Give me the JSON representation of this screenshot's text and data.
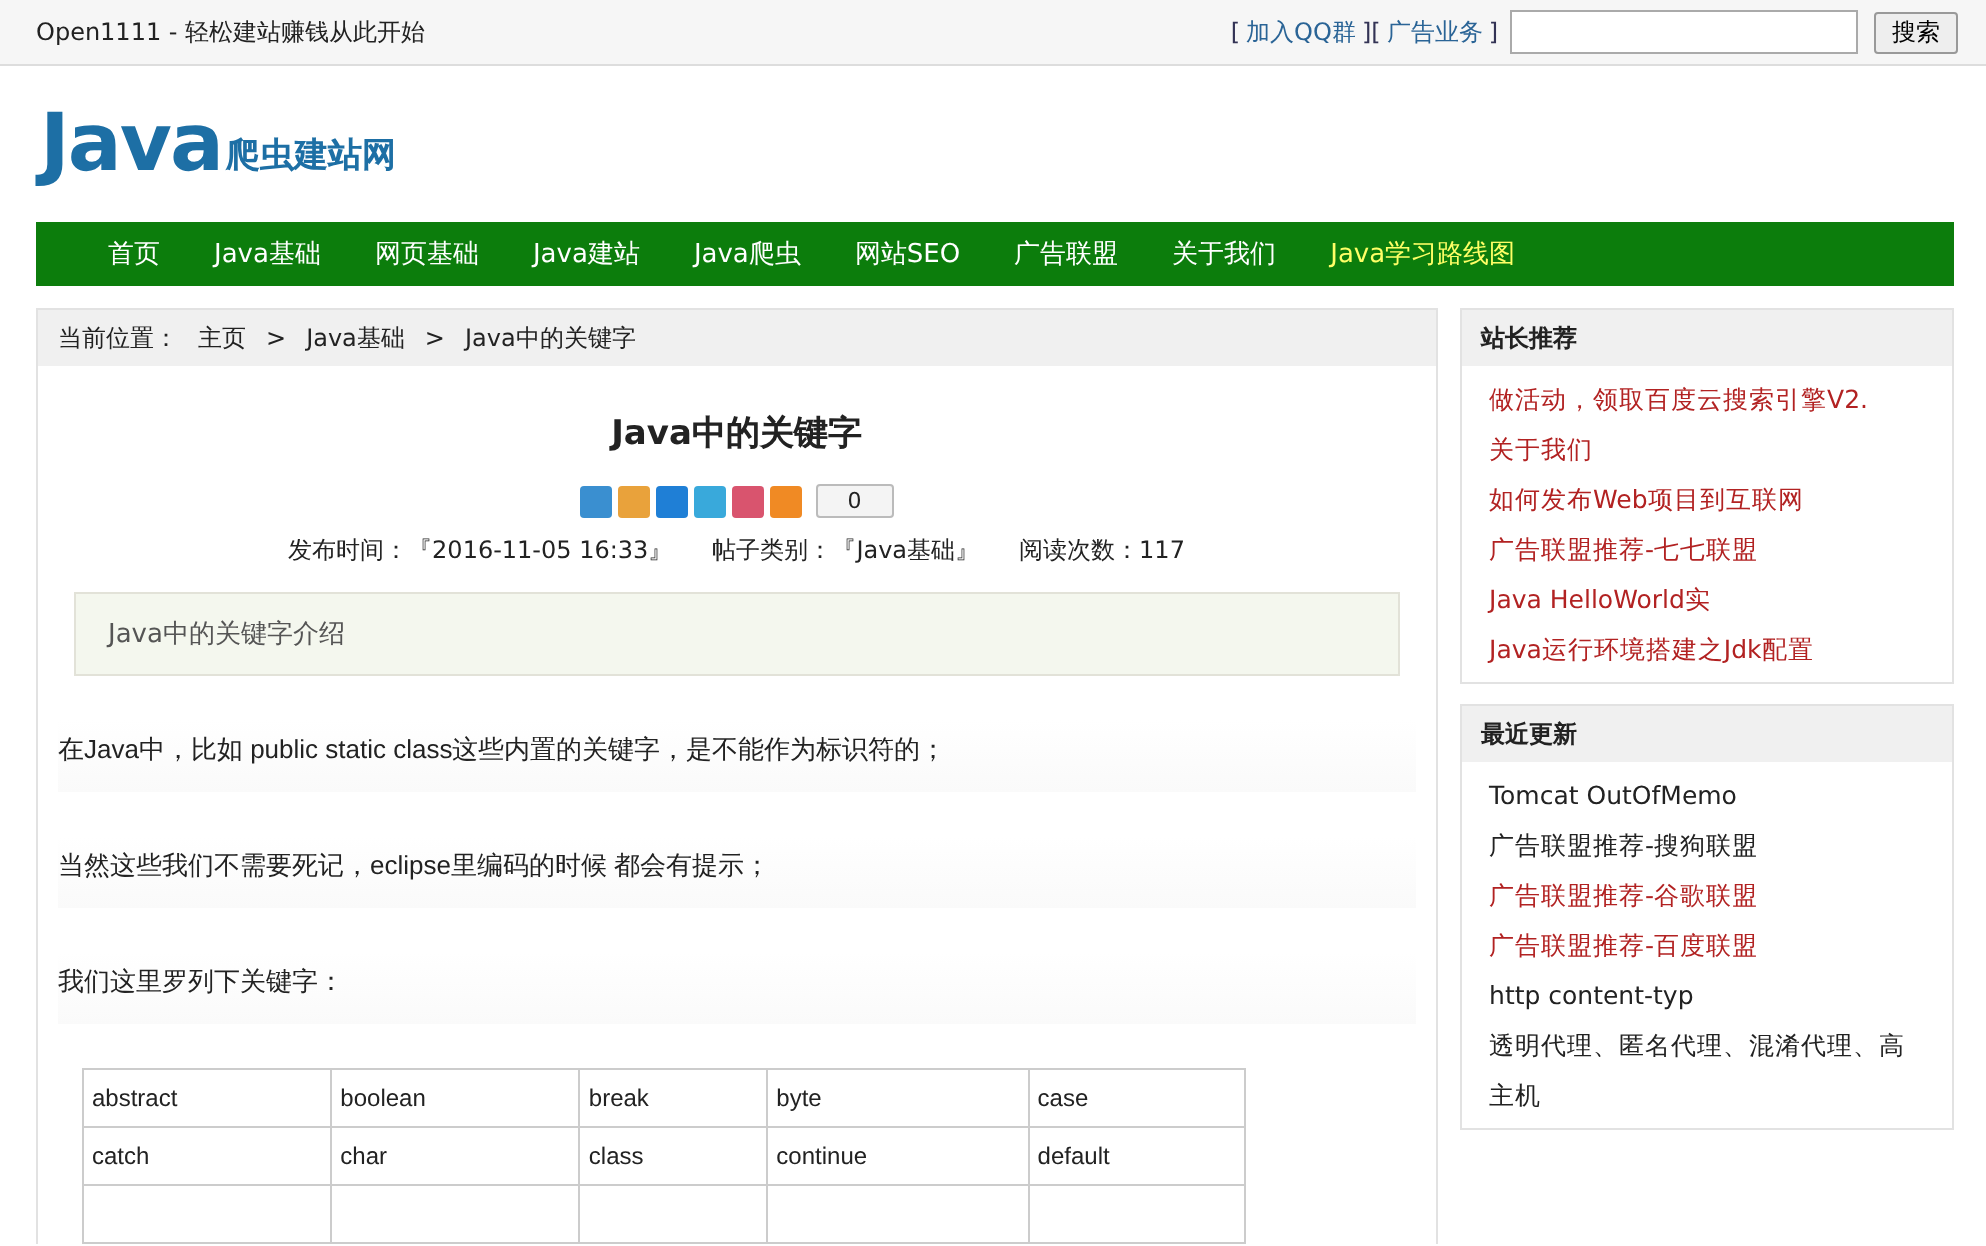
{
  "top_bar": {
    "tagline": "Open1111 - 轻松建站赚钱从此开始",
    "links": [
      "加入QQ群",
      "广告业务"
    ],
    "brackets": [
      "[",
      "][",
      "]"
    ],
    "search_button": "搜索"
  },
  "logo": {
    "main": "Java",
    "sub": "爬虫建站网"
  },
  "nav": [
    {
      "label": "首页",
      "highlight": false
    },
    {
      "label": "Java基础",
      "highlight": false
    },
    {
      "label": "网页基础",
      "highlight": false
    },
    {
      "label": "Java建站",
      "highlight": false
    },
    {
      "label": "Java爬虫",
      "highlight": false
    },
    {
      "label": "网站SEO",
      "highlight": false
    },
    {
      "label": "广告联盟",
      "highlight": false
    },
    {
      "label": "关于我们",
      "highlight": false
    },
    {
      "label": "Java学习路线图",
      "highlight": true
    }
  ],
  "breadcrumb": {
    "label": "当前位置：",
    "separator": ">",
    "items": [
      "主页",
      "Java基础",
      "Java中的关键字"
    ]
  },
  "article": {
    "title": "Java中的关键字",
    "share_count": "0",
    "meta": [
      "发布时间：『2016-11-05 16:33』",
      "帖子类别：『Java基础』",
      "阅读次数：117"
    ],
    "summary": "Java中的关键字介绍",
    "paragraphs": [
      "在Java中，比如 public static class这些内置的关键字，是不能作为标识符的；",
      "当然这些我们不需要死记，eclipse里编码的时候 都会有提示；",
      "我们这里罗列下关键字："
    ],
    "table_rows": [
      [
        "abstract",
        "boolean",
        "break",
        "byte",
        "case"
      ],
      [
        "catch",
        "char",
        "class",
        "continue",
        "default"
      ]
    ]
  },
  "sidebar": [
    {
      "title": "站长推荐",
      "items": [
        {
          "label": "做活动，领取百度云搜索引擎V2.",
          "color": "#b22222"
        },
        {
          "label": "关于我们",
          "color": "#b22222"
        },
        {
          "label": "如何发布Web项目到互联网",
          "color": "#b22222"
        },
        {
          "label": "广告联盟推荐-七七联盟",
          "color": "#b22222"
        },
        {
          "label": "Java HelloWorld实",
          "color": "#b22222"
        },
        {
          "label": "Java运行环境搭建之Jdk配置",
          "color": "#b22222"
        }
      ]
    },
    {
      "title": "最近更新",
      "items": [
        {
          "label": "Tomcat OutOfMemo",
          "color": "#222222"
        },
        {
          "label": "广告联盟推荐-搜狗联盟",
          "color": "#222222"
        },
        {
          "label": "广告联盟推荐-谷歌联盟",
          "color": "#b22222"
        },
        {
          "label": "广告联盟推荐-百度联盟",
          "color": "#b22222"
        },
        {
          "label": "http content-typ",
          "color": "#222222"
        },
        {
          "label": "透明代理、匿名代理、混淆代理、高",
          "color": "#222222"
        },
        {
          "label": "主机",
          "color": "#222222"
        }
      ]
    }
  ]
}
